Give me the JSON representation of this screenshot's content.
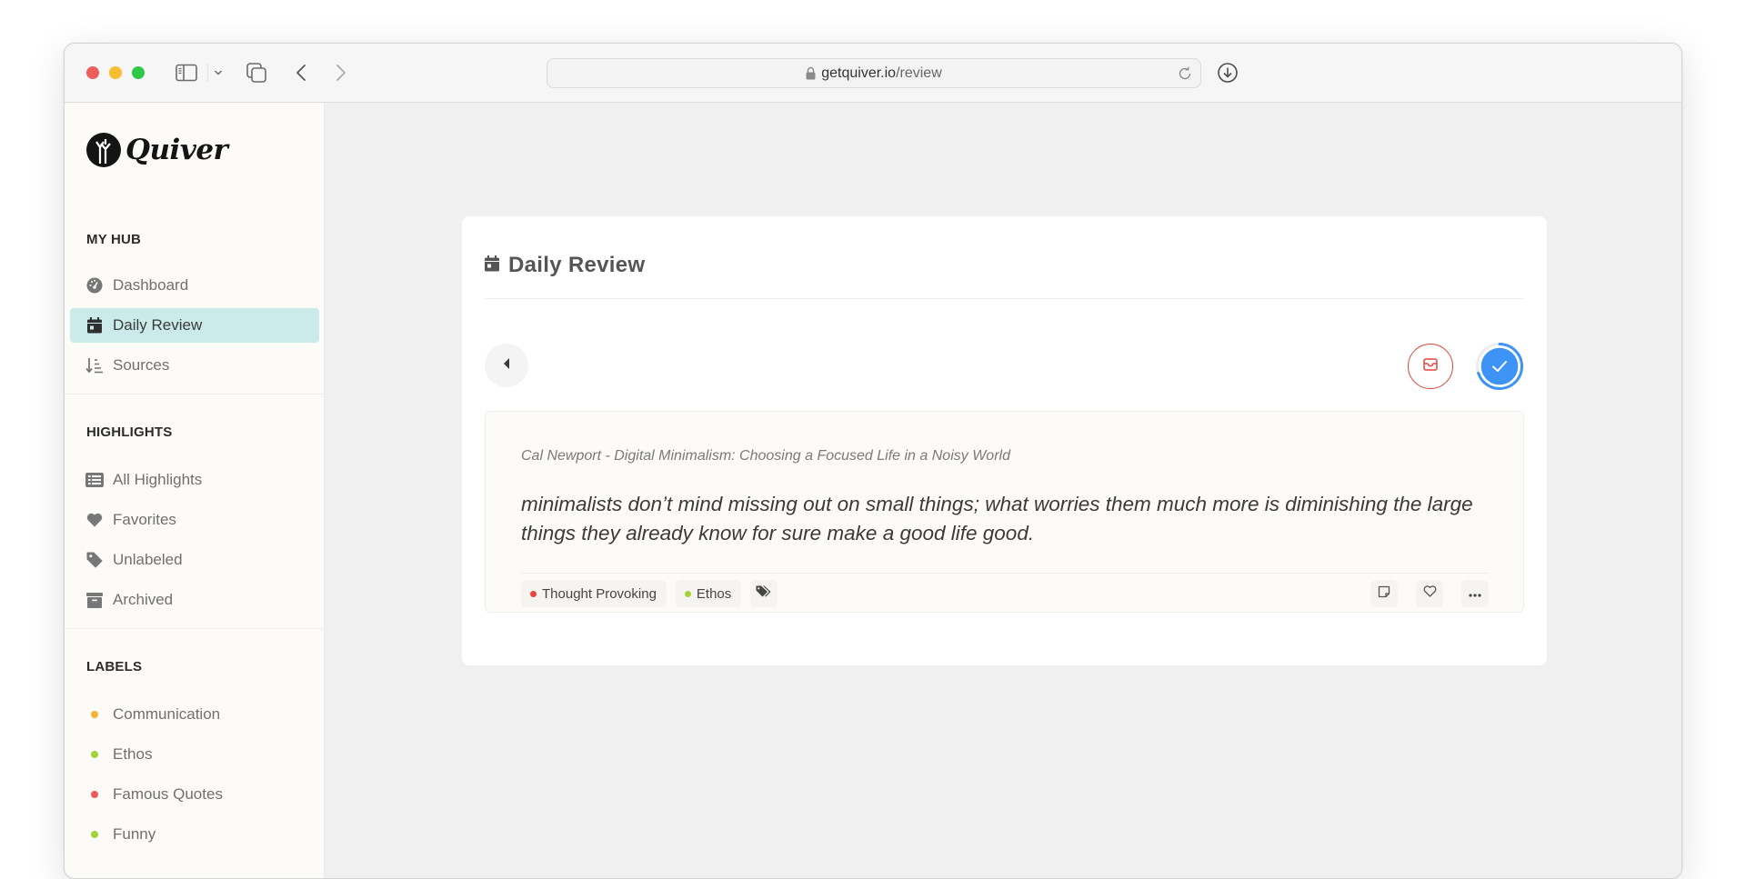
{
  "browser": {
    "url_domain": "getquiver.io",
    "url_path": "/review",
    "icons": [
      "sidebar-toggle-icon",
      "chevron-down-icon",
      "tabs-overview-icon",
      "back-arrow-icon",
      "forward-arrow-icon",
      "lock-icon",
      "reload-icon",
      "download-icon"
    ]
  },
  "sidebar": {
    "logo_text": "Quiver",
    "sections": [
      {
        "title": "MY HUB",
        "items": [
          {
            "label": "Dashboard",
            "icon": "dashboard-gauge-icon",
            "active": false
          },
          {
            "label": "Daily Review",
            "icon": "calendar-icon",
            "active": true
          },
          {
            "label": "Sources",
            "icon": "sort-descending-icon",
            "active": false
          }
        ]
      },
      {
        "title": "HIGHLIGHTS",
        "items": [
          {
            "label": "All Highlights",
            "icon": "list-icon",
            "active": false
          },
          {
            "label": "Favorites",
            "icon": "heart-icon",
            "active": false
          },
          {
            "label": "Unlabeled",
            "icon": "tag-icon",
            "active": false
          },
          {
            "label": "Archived",
            "icon": "archive-box-icon",
            "active": false
          }
        ]
      },
      {
        "title": "LABELS",
        "items": [
          {
            "label": "Communication",
            "color": "#f5b236"
          },
          {
            "label": "Ethos",
            "color": "#a3d435"
          },
          {
            "label": "Famous Quotes",
            "color": "#ef5a5a"
          },
          {
            "label": "Funny",
            "color": "#a3d435"
          }
        ]
      }
    ]
  },
  "review": {
    "title": "Daily Review",
    "progress_fraction": 0.7,
    "accent_color": "#3d94f6",
    "archive_color": "#e0463c",
    "highlight": {
      "source": "Cal Newport - Digital Minimalism: Choosing a Focused Life in a Noisy World",
      "text": "minimalists don’t mind missing out on small things; what worries them much more is diminishing the large things they already know for sure make a good life good.",
      "tags": [
        {
          "label": "Thought Provoking",
          "color": "#e8453c"
        },
        {
          "label": "Ethos",
          "color": "#a3d435"
        }
      ],
      "actions": [
        "note-icon",
        "heart-outline-icon",
        "more-dots-icon"
      ]
    }
  }
}
